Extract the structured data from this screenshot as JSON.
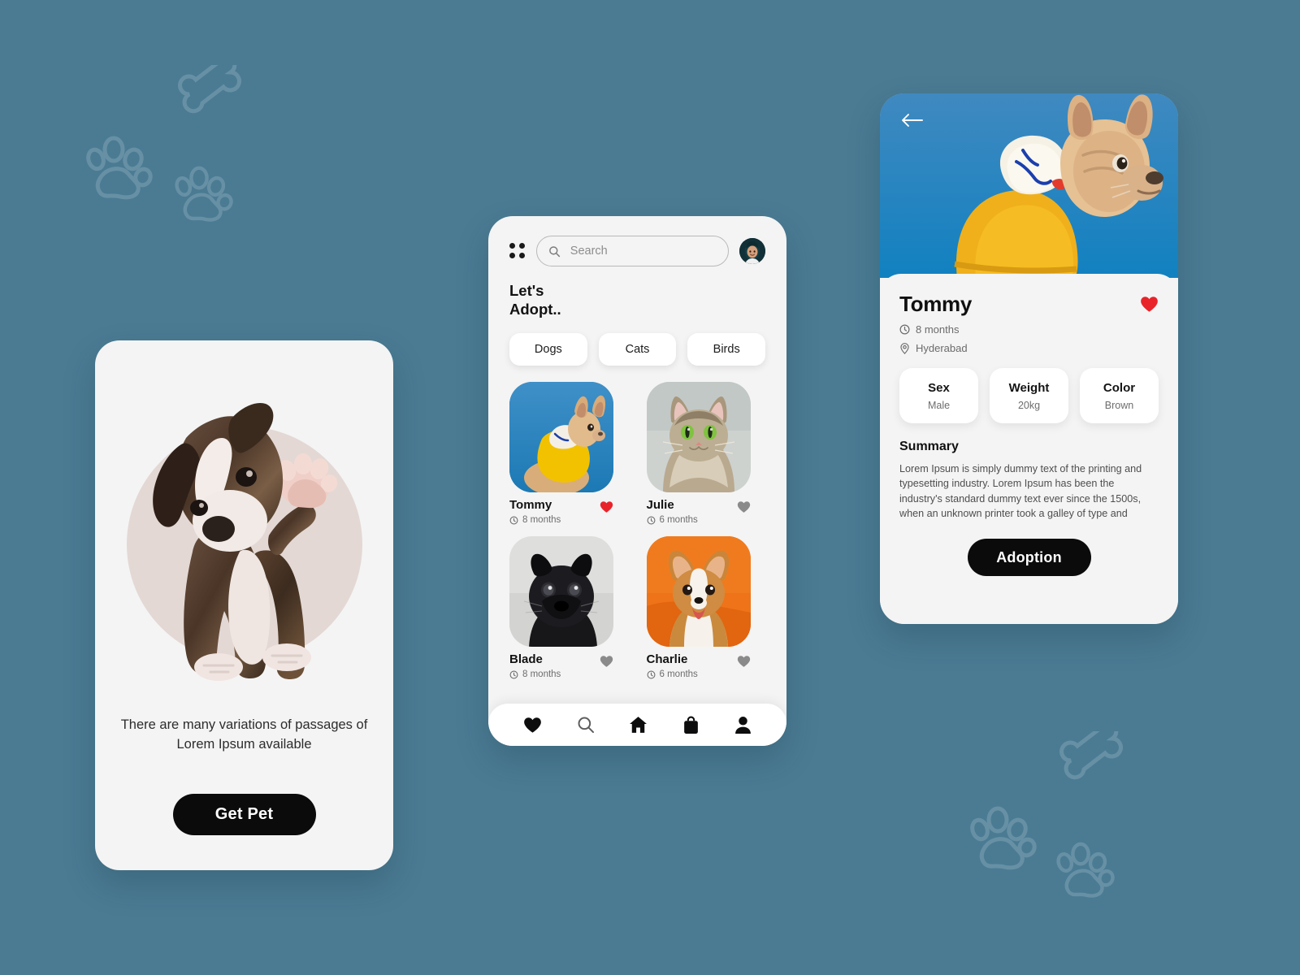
{
  "theme": {
    "background": "#4a7b93",
    "card_background": "#f4f4f4",
    "chip_background": "#ffffff",
    "button_dark": "#0b0b0b",
    "heart_active": "#e8242a",
    "heart_inactive": "#8a8a8a",
    "hero_blue_top": "#4089c0",
    "hero_blue_bottom": "#1387c4",
    "beige_circle": "#e3d8d4"
  },
  "onboarding": {
    "illustration_alt": "boxer-puppy-waving-paw",
    "description": "There are many variations of passages of Lorem Ipsum available",
    "cta_label": "Get Pet"
  },
  "list_screen": {
    "menu_icon": "grid-dots-icon",
    "search": {
      "icon": "search-icon",
      "placeholder": "Search",
      "value": ""
    },
    "avatar": "user-avatar",
    "headline_line1": "Let's",
    "headline_line2": "Adopt..",
    "categories": [
      {
        "label": "Dogs"
      },
      {
        "label": "Cats"
      },
      {
        "label": "Birds"
      }
    ],
    "pets": [
      {
        "name": "Tommy",
        "age": "8 months",
        "favorite": true,
        "photo": "french-bulldog-yellow-hoodie"
      },
      {
        "name": "Julie",
        "age": "6 months",
        "favorite": false,
        "photo": "long-haired-tabby-cat"
      },
      {
        "name": "Blade",
        "age": "8 months",
        "favorite": false,
        "photo": "black-pug-portrait"
      },
      {
        "name": "Charlie",
        "age": "6 months",
        "favorite": false,
        "photo": "corgi-puppy-orange-background"
      }
    ],
    "nav_items": [
      {
        "icon": "heart-icon",
        "active": true
      },
      {
        "icon": "search-icon",
        "active": false
      },
      {
        "icon": "home-icon",
        "active": true
      },
      {
        "icon": "shopping-bag-icon",
        "active": true
      },
      {
        "icon": "person-icon",
        "active": true
      }
    ]
  },
  "detail_screen": {
    "back_icon": "back-arrow-icon",
    "hero_photo": "french-bulldog-yellow-hoodie",
    "name": "Tommy",
    "favorite": true,
    "age": "8 months",
    "age_icon": "clock-icon",
    "location": "Hyderabad",
    "location_icon": "map-pin-icon",
    "attributes": [
      {
        "label": "Sex",
        "value": "Male"
      },
      {
        "label": "Weight",
        "value": "20kg"
      },
      {
        "label": "Color",
        "value": "Brown"
      }
    ],
    "summary_title": "Summary",
    "summary_text": "Lorem Ipsum is simply dummy text of the printing and typesetting industry. Lorem Ipsum has been the industry's standard dummy text ever since the 1500s, when an unknown printer took a galley of type and",
    "cta_label": "Adoption"
  }
}
